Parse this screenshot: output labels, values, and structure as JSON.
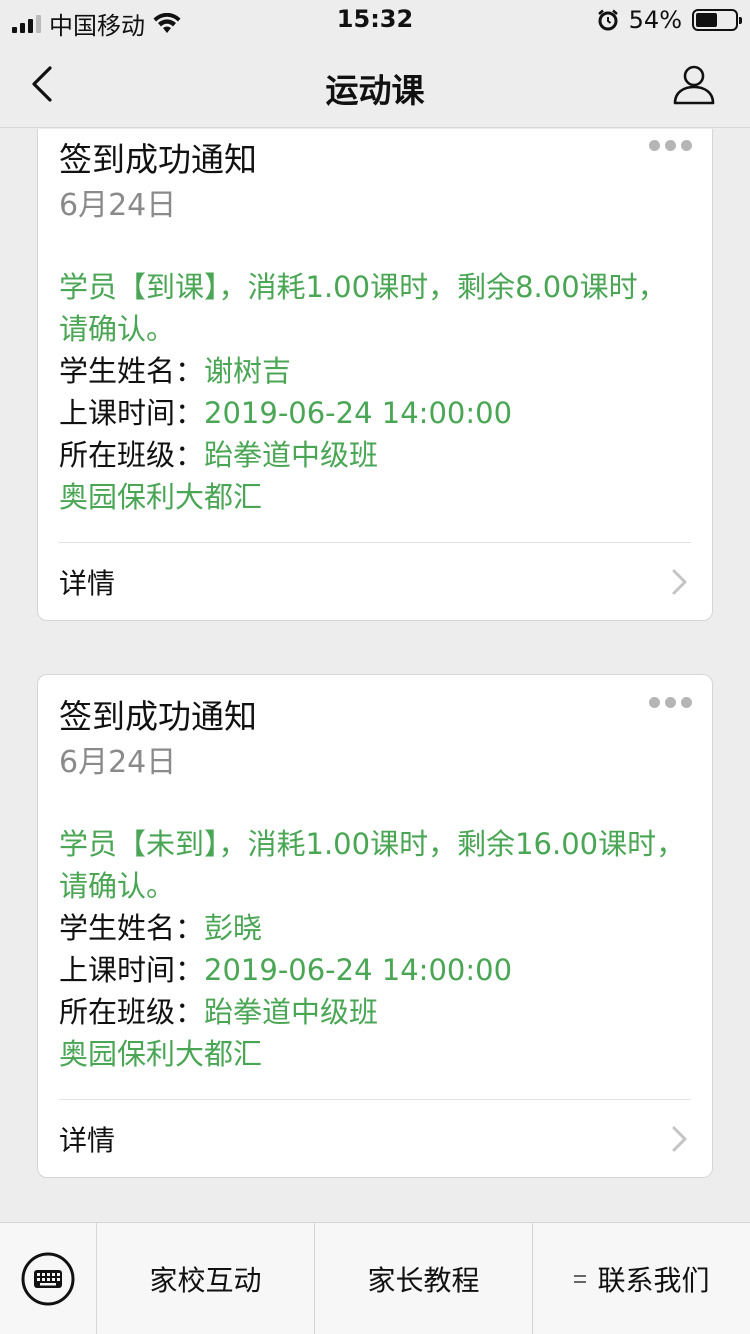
{
  "status_bar": {
    "carrier": "中国移动",
    "time": "15:32",
    "battery_text": "54%",
    "battery_level": 0.54
  },
  "nav": {
    "title": "运动课"
  },
  "cards": [
    {
      "title": "签到成功通知",
      "date": "6月24日",
      "message": "学员【到课】，消耗1.00课时，剩余8.00课时，请确认。",
      "student_label": "学生姓名：",
      "student_value": "谢树吉",
      "time_label": "上课时间：",
      "time_value": "2019-06-24 14:00:00",
      "class_label": "所在班级：",
      "class_value": "跆拳道中级班",
      "location": "奥园保利大都汇",
      "detail_label": "详情"
    },
    {
      "title": "签到成功通知",
      "date": "6月24日",
      "message": "学员【未到】，消耗1.00课时，剩余16.00课时，请确认。",
      "student_label": "学生姓名：",
      "student_value": "彭晓",
      "time_label": "上课时间：",
      "time_value": "2019-06-24 14:00:00",
      "class_label": "所在班级：",
      "class_value": "跆拳道中级班",
      "location": "奥园保利大都汇",
      "detail_label": "详情"
    }
  ],
  "bottom_menu": {
    "items": [
      "家校互动",
      "家长教程",
      "联系我们"
    ]
  },
  "colors": {
    "accent_green": "#4aa655",
    "background": "#ededed"
  }
}
